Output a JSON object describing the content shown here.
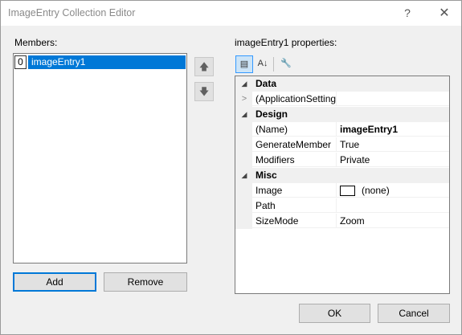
{
  "window": {
    "title": "ImageEntry Collection Editor",
    "help_glyph": "?",
    "close_glyph": "✕"
  },
  "members": {
    "label": "Members:",
    "items": [
      {
        "index": "0",
        "name": "imageEntry1",
        "selected": true
      }
    ],
    "move_up_glyph": "🡅",
    "move_down_glyph": "🡇",
    "add_label": "Add",
    "remove_label": "Remove"
  },
  "properties": {
    "label": "imageEntry1 properties:",
    "toolbar": {
      "categorized_glyph": "▤",
      "alphabetical_glyph": "A↓",
      "property_pages_glyph": "🔧"
    },
    "categories": [
      {
        "name": "Data",
        "expanded": true,
        "rows": [
          {
            "name": "(ApplicationSettings)",
            "value": "",
            "expandable": true
          }
        ]
      },
      {
        "name": "Design",
        "expanded": true,
        "rows": [
          {
            "name": "(Name)",
            "value": "imageEntry1",
            "bold": true
          },
          {
            "name": "GenerateMember",
            "value": "True"
          },
          {
            "name": "Modifiers",
            "value": "Private"
          }
        ]
      },
      {
        "name": "Misc",
        "expanded": true,
        "rows": [
          {
            "name": "Image",
            "value": "(none)",
            "swatch": true
          },
          {
            "name": "Path",
            "value": ""
          },
          {
            "name": "SizeMode",
            "value": "Zoom"
          }
        ]
      }
    ]
  },
  "footer": {
    "ok_label": "OK",
    "cancel_label": "Cancel"
  },
  "colors": {
    "accent": "#0078d7",
    "window_bg": "#f0f0f0"
  }
}
